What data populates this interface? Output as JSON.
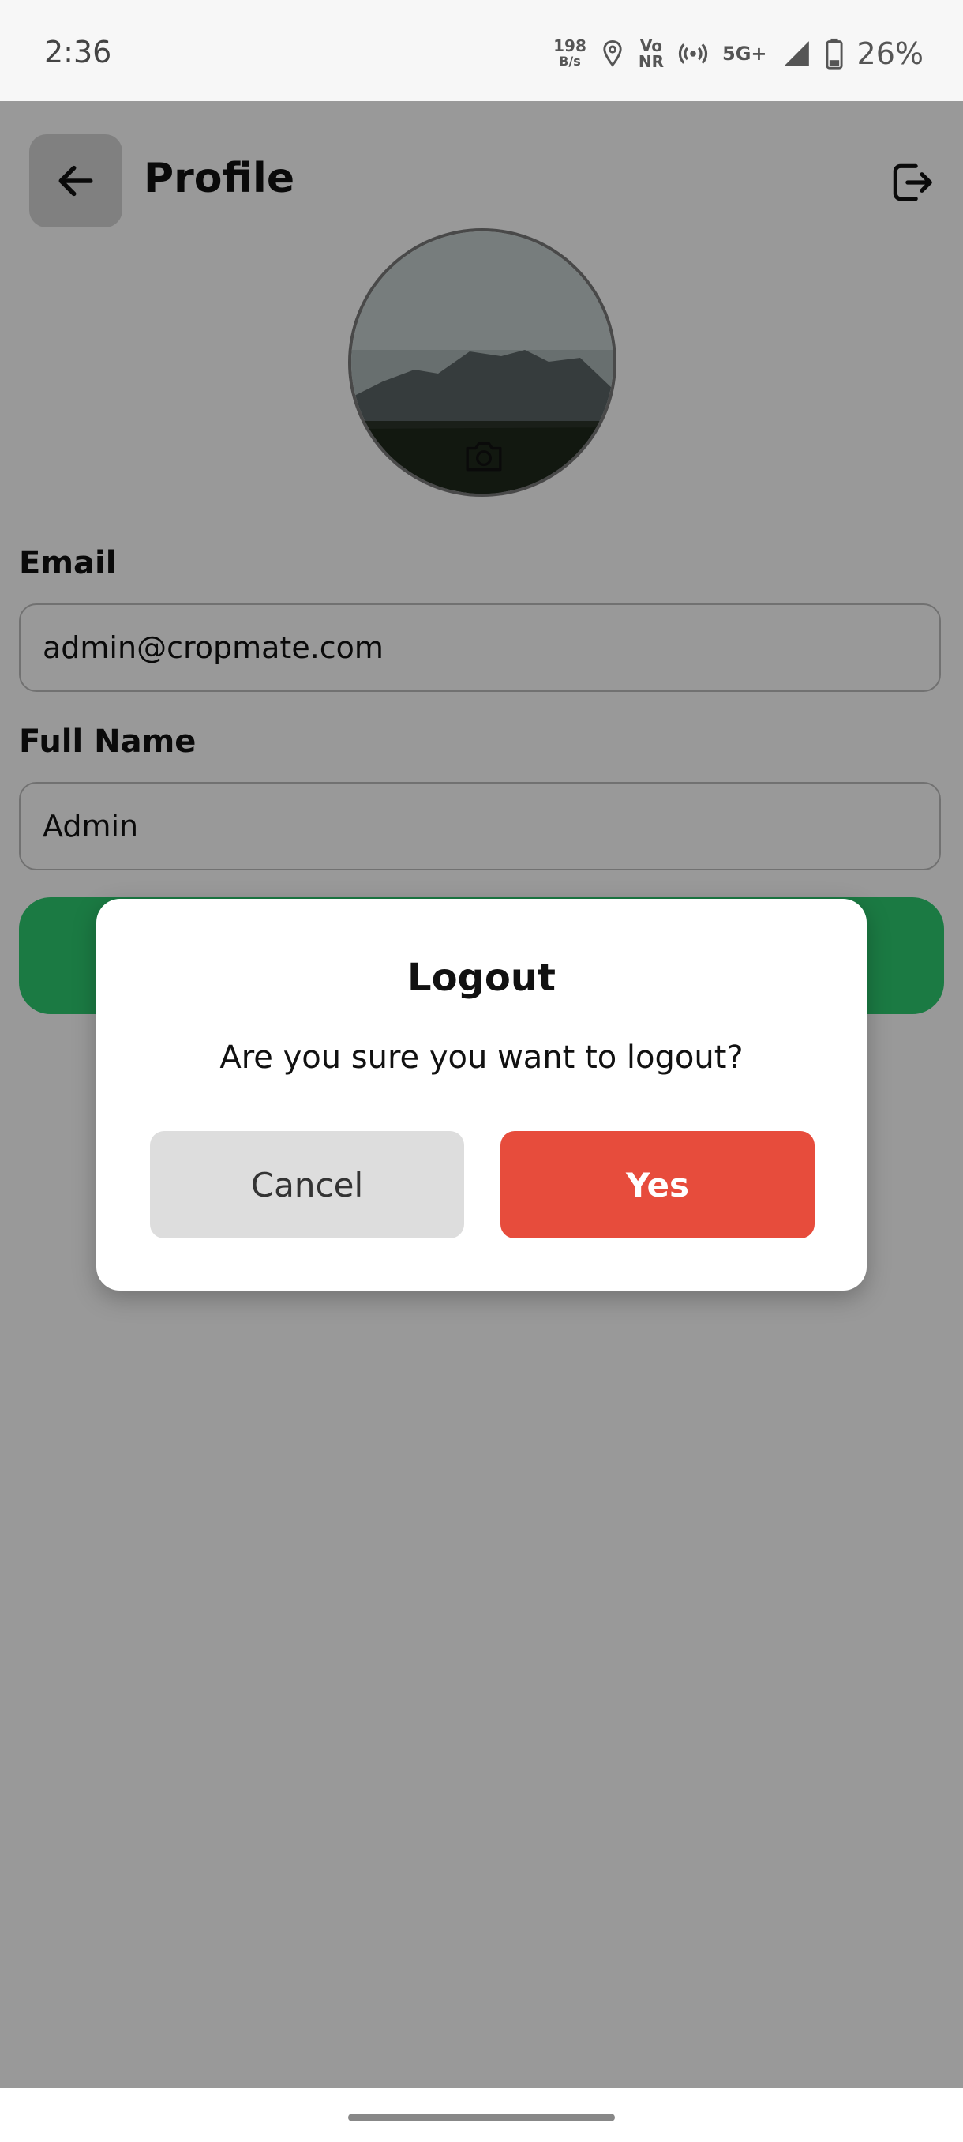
{
  "status_bar": {
    "time": "2:36",
    "data_speed_value": "198",
    "data_speed_unit": "B/s",
    "volte_top": "Vo",
    "volte_bottom": "NR",
    "network": "5G+",
    "battery": "26%",
    "icons": [
      "location-icon",
      "hotspot-icon",
      "signal-icon",
      "battery-icon"
    ]
  },
  "header": {
    "title": "Profile",
    "back_icon": "arrow-left-icon",
    "logout_icon": "logout-icon"
  },
  "profile": {
    "avatar_icon": "camera-icon"
  },
  "form": {
    "email_label": "Email",
    "email_value": "admin@cropmate.com",
    "name_label": "Full Name",
    "name_value": "Admin"
  },
  "dialog": {
    "title": "Logout",
    "message": "Are you sure you want to logout?",
    "cancel_label": "Cancel",
    "confirm_label": "Yes"
  },
  "colors": {
    "accent_green": "#2ecc71",
    "danger_red": "#e74c3c",
    "cancel_gray": "#dddddd"
  }
}
